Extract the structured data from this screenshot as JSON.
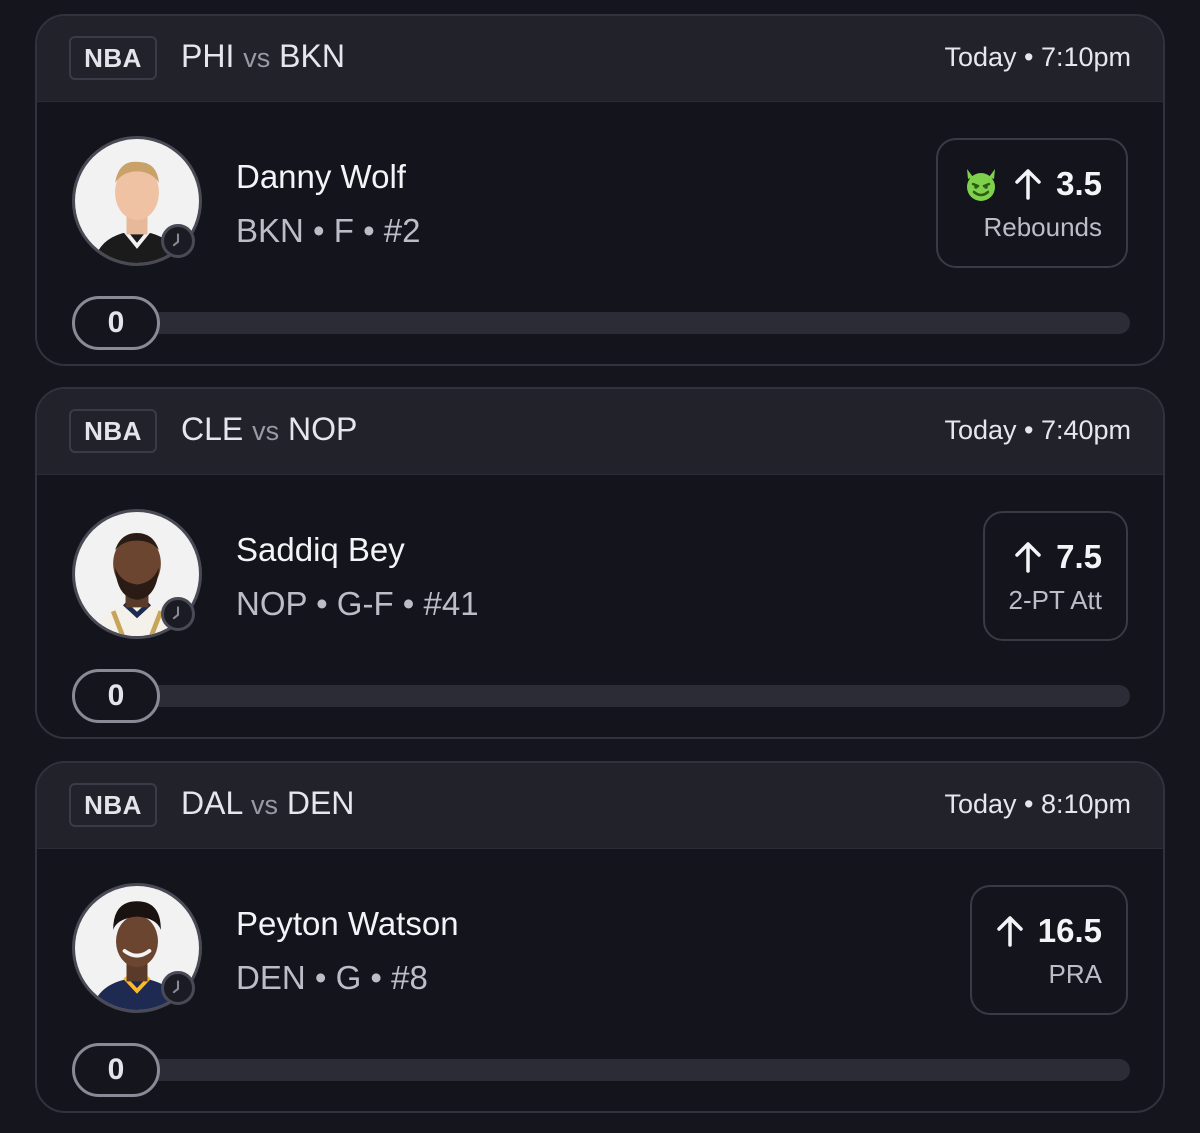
{
  "picks": [
    {
      "league": "NBA",
      "away_team": "PHI",
      "vs": "vs",
      "home_team": "BKN",
      "time": "Today • 7:10pm",
      "player_name": "Danny Wolf",
      "player_meta": "BKN • F • #2",
      "value": "3.5",
      "stat": "Rebounds",
      "direction": "up-arrow-icon",
      "modifier_icon": "green-devil-emoji-icon",
      "current": "0",
      "progress_fraction": 0
    },
    {
      "league": "NBA",
      "away_team": "CLE",
      "vs": "vs",
      "home_team": "NOP",
      "time": "Today • 7:40pm",
      "player_name": "Saddiq Bey",
      "player_meta": "NOP • G-F • #41",
      "value": "7.5",
      "stat": "2-PT Att",
      "direction": "up-arrow-icon",
      "current": "0",
      "progress_fraction": 0
    },
    {
      "league": "NBA",
      "away_team": "DAL",
      "vs": "vs",
      "home_team": "DEN",
      "time": "Today • 8:10pm",
      "player_name": "Peyton Watson",
      "player_meta": "DEN • G • #8",
      "value": "16.5",
      "stat": "PRA",
      "direction": "up-arrow-icon",
      "current": "0",
      "progress_fraction": 0
    }
  ],
  "colors": {
    "background": "#15151e",
    "card_header": "#22222b",
    "devil_green": "#7ed14b",
    "progress_track": "#2c2c36"
  }
}
